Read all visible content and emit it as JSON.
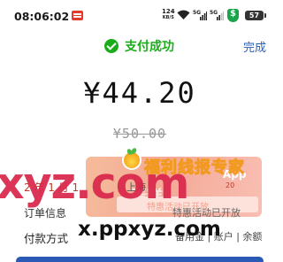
{
  "status_bar": {
    "time": "08:06:02",
    "speed_value": "124",
    "speed_unit": "KB/S",
    "signal_1": "5G",
    "signal_2": "5G",
    "battery": "57"
  },
  "header": {
    "title": "支付成功",
    "done_label": "完成"
  },
  "payment": {
    "amount": "¥44.20",
    "original_amount": "¥50.00"
  },
  "details": {
    "row1_label": "2 年 1 月 1",
    "row1_value": "上海",
    "row2_label": "订单信息",
    "row2_value": "特惠活动已开放",
    "row3_label": "付款方式",
    "row3_value": "备用金 | 账户 | 余额"
  },
  "promo": {
    "app_tag": "App",
    "app_sub": "20",
    "glyph": "蛋糕",
    "inner_text": "特惠活动已开放"
  },
  "watermark": {
    "site_name": "福利线报专家",
    "big_text": "xyz.com",
    "small_text": "x.ppxyz.com"
  },
  "colors": {
    "success_green": "#1aad19",
    "link_blue": "#2b5fb8",
    "watermark_red": "#d9264a"
  }
}
